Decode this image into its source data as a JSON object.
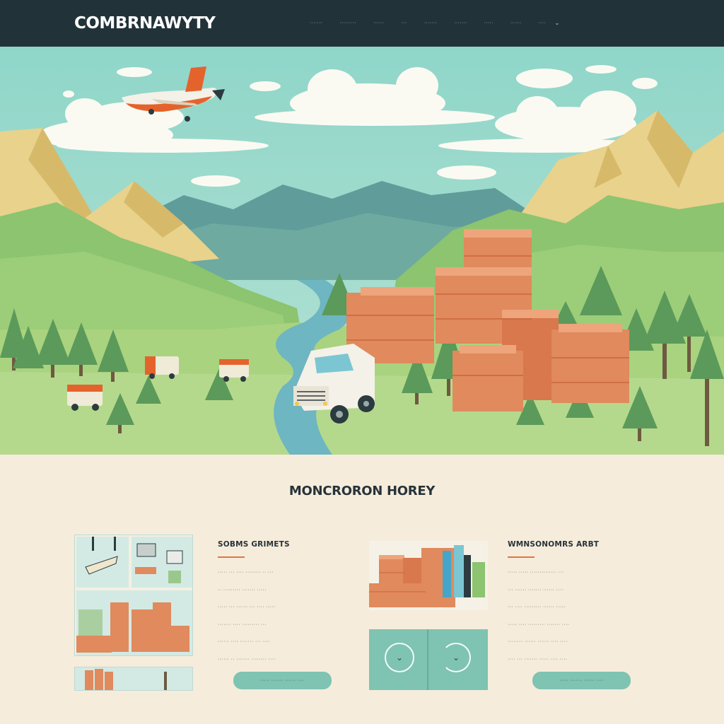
{
  "brand": {
    "logo": "COMBRNAWYTY"
  },
  "nav": {
    "items": [
      "·······",
      "·········",
      "······",
      "···",
      "·······",
      "·······",
      "·····",
      "······",
      "····"
    ],
    "dropdown_icon": "chevron-down-icon"
  },
  "section": {
    "title": "MONCRORON HOREY"
  },
  "col_left": {
    "title": "SOBMS GRIMETS",
    "lines": [
      "····· ··· ···· ········ ·· ···",
      "·· ········· ······· ·····",
      "····· ··· ······ ··· ···· ·····",
      "······· ···· ········· ···",
      "······ ···· ······· ··· ····",
      "······ ·· ······· ········ ····"
    ],
    "button_label": "····· ······· ······ ····"
  },
  "col_right": {
    "title": "WMNSONOMRS ARBT",
    "lines": [
      "····· ····· ·············· ···",
      "··· ······ ······· ······ ····",
      "··· ···· ········· ······ ·····",
      "····· ···· ········· ······· ····",
      "········ ······ ······ ···· ····",
      "···· ··· ······· ····· ···· ····"
    ],
    "button_label": "····· ······· ······ ····"
  },
  "colors": {
    "nav_bg": "#223239",
    "sky": "#8fd3c7",
    "accent_orange": "#e0763f",
    "button_teal": "#7fc3b2",
    "page_bg": "#f6ecdb",
    "crate": "#e08a5d"
  },
  "icons": [
    "airplane-icon",
    "delivery-truck-icon",
    "chevron-down-icon",
    "arrow-circle-left-icon",
    "arrow-circle-right-icon"
  ]
}
